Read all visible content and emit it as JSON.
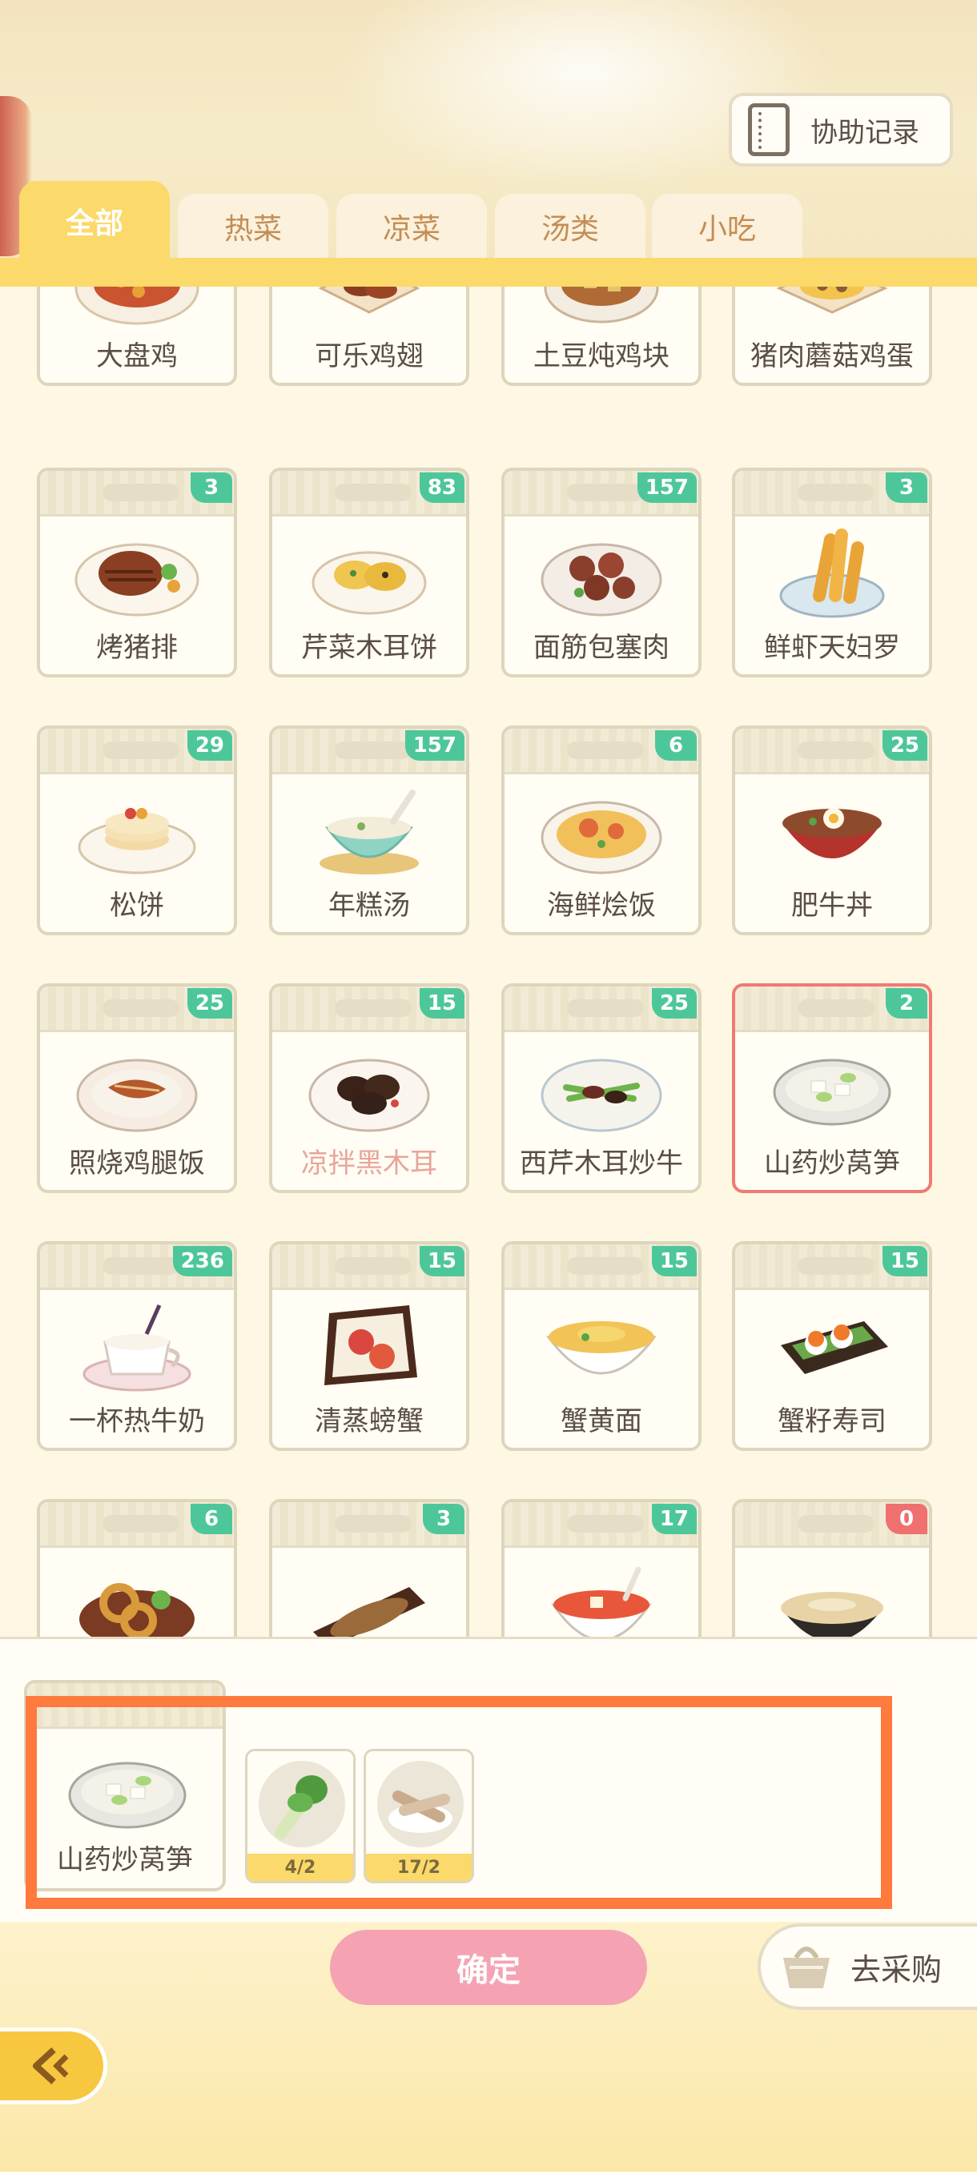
{
  "header": {
    "assist_record_label": "协助记录"
  },
  "tabs": [
    {
      "label": "全部",
      "active": true
    },
    {
      "label": "热菜",
      "active": false
    },
    {
      "label": "凉菜",
      "active": false
    },
    {
      "label": "汤类",
      "active": false
    },
    {
      "label": "小吃",
      "active": false
    }
  ],
  "dishes": [
    {
      "name": "大盘鸡",
      "count": "",
      "icon": "spicy-chicken-plate-icon"
    },
    {
      "name": "可乐鸡翅",
      "count": "",
      "icon": "cola-wings-icon"
    },
    {
      "name": "土豆炖鸡块",
      "count": "",
      "icon": "potato-chicken-stew-icon"
    },
    {
      "name": "猪肉蘑菇鸡蛋",
      "count": "",
      "icon": "pork-mushroom-egg-icon"
    },
    {
      "name": "烤猪排",
      "count": "3",
      "icon": "grilled-pork-chop-icon"
    },
    {
      "name": "芹菜木耳饼",
      "count": "83",
      "icon": "celery-fungus-pancake-icon"
    },
    {
      "name": "面筋包塞肉",
      "count": "157",
      "icon": "stuffed-gluten-icon"
    },
    {
      "name": "鲜虾天妇罗",
      "count": "3",
      "icon": "shrimp-tempura-icon"
    },
    {
      "name": "松饼",
      "count": "29",
      "icon": "pancake-icon"
    },
    {
      "name": "年糕汤",
      "count": "157",
      "icon": "rice-cake-soup-icon"
    },
    {
      "name": "海鲜烩饭",
      "count": "6",
      "icon": "seafood-risotto-icon"
    },
    {
      "name": "肥牛丼",
      "count": "25",
      "icon": "beef-bowl-icon"
    },
    {
      "name": "照烧鸡腿饭",
      "count": "25",
      "icon": "teriyaki-chicken-rice-icon"
    },
    {
      "name": "凉拌黑木耳",
      "count": "15",
      "icon": "black-fungus-salad-icon"
    },
    {
      "name": "西芹木耳炒牛",
      "count": "25",
      "icon": "celery-beef-stirfry-icon"
    },
    {
      "name": "山药炒莴笋",
      "count": "2",
      "icon": "yam-lettuce-stirfry-icon",
      "selected": true
    },
    {
      "name": "一杯热牛奶",
      "count": "236",
      "icon": "hot-milk-icon"
    },
    {
      "name": "清蒸螃蟹",
      "count": "15",
      "icon": "steamed-crab-icon"
    },
    {
      "name": "蟹黄面",
      "count": "15",
      "icon": "crab-roe-noodles-icon"
    },
    {
      "name": "蟹籽寿司",
      "count": "15",
      "icon": "crab-roe-sushi-icon"
    },
    {
      "name": "",
      "count": "6",
      "icon": "onion-ring-salad-icon"
    },
    {
      "name": "",
      "count": "3",
      "icon": "grilled-fish-icon"
    },
    {
      "name": "",
      "count": "17",
      "icon": "tofu-soup-icon"
    },
    {
      "name": "",
      "count": "0",
      "icon": "noodle-bowl-icon"
    }
  ],
  "selection": {
    "dish_name": "山药炒莴笋",
    "ingredients": [
      {
        "icon": "lettuce-stem-icon",
        "qty": "4/2"
      },
      {
        "icon": "yam-icon",
        "qty": "17/2"
      }
    ]
  },
  "actions": {
    "confirm_label": "确定",
    "shop_label": "去采购"
  },
  "colors": {
    "accent_yellow": "#fbd96a",
    "badge_green": "#4dc79a",
    "badge_red": "#f06f6f",
    "confirm_pink": "#f5a3b2",
    "highlight_orange": "#ff7a3d"
  }
}
